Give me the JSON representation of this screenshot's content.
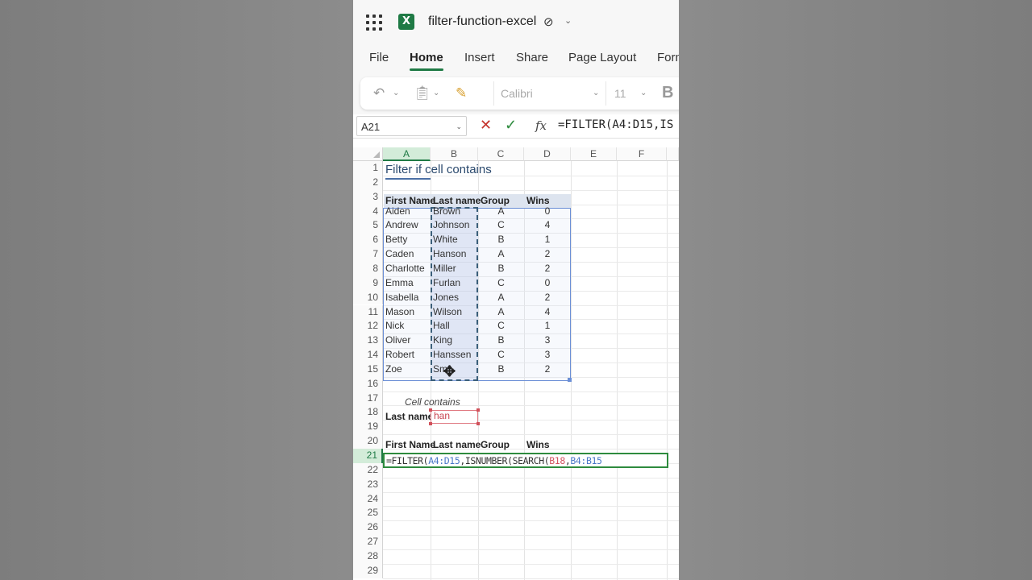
{
  "app": {
    "doc_title": "filter-function-excel",
    "status_icon": "✓",
    "accent": "#1f7a45"
  },
  "tabs": [
    "File",
    "Home",
    "Insert",
    "Share",
    "Page Layout",
    "Form"
  ],
  "toolbar": {
    "font_name": "Calibri",
    "font_size": "11",
    "bold_label": "B"
  },
  "formula_bar": {
    "name_box": "A21",
    "fx_label": "fx",
    "formula": "=FILTER(A4:D15,IS"
  },
  "columns": [
    "A",
    "B",
    "C",
    "D",
    "E",
    "F"
  ],
  "rows": [
    "1",
    "2",
    "3",
    "4",
    "5",
    "6",
    "7",
    "8",
    "9",
    "10",
    "11",
    "12",
    "13",
    "14",
    "15",
    "16",
    "17",
    "18",
    "19",
    "20",
    "21",
    "22",
    "23",
    "24",
    "25",
    "26",
    "27",
    "28",
    "29"
  ],
  "sheet": {
    "title": "Filter if cell contains",
    "headers": [
      "First Name",
      "Last name",
      "Group",
      "Wins"
    ],
    "data": [
      [
        "Aiden",
        "Brown",
        "A",
        "0"
      ],
      [
        "Andrew",
        "Johnson",
        "C",
        "4"
      ],
      [
        "Betty",
        "White",
        "B",
        "1"
      ],
      [
        "Caden",
        "Hanson",
        "A",
        "2"
      ],
      [
        "Charlotte",
        "Miller",
        "B",
        "2"
      ],
      [
        "Emma",
        "Furlan",
        "C",
        "0"
      ],
      [
        "Isabella",
        "Jones",
        "A",
        "2"
      ],
      [
        "Mason",
        "Wilson",
        "A",
        "4"
      ],
      [
        "Nick",
        "Hall",
        "C",
        "1"
      ],
      [
        "Oliver",
        "King",
        "B",
        "3"
      ],
      [
        "Robert",
        "Hanssen",
        "C",
        "3"
      ],
      [
        "Zoe",
        "Sm",
        "B",
        "2"
      ]
    ],
    "criteria_caption": "Cell contains",
    "criteria_label": "Last name",
    "criteria_value": "han",
    "result_headers": [
      "First Name",
      "Last name",
      "Group",
      "Wins"
    ],
    "edit_formula": {
      "p1": "=FILTER(",
      "p2": "A4:D15",
      "p3": ",ISNUMBER(SEARCH(",
      "p4": "B18",
      "p5": ",",
      "p6": "B4:B15"
    }
  }
}
